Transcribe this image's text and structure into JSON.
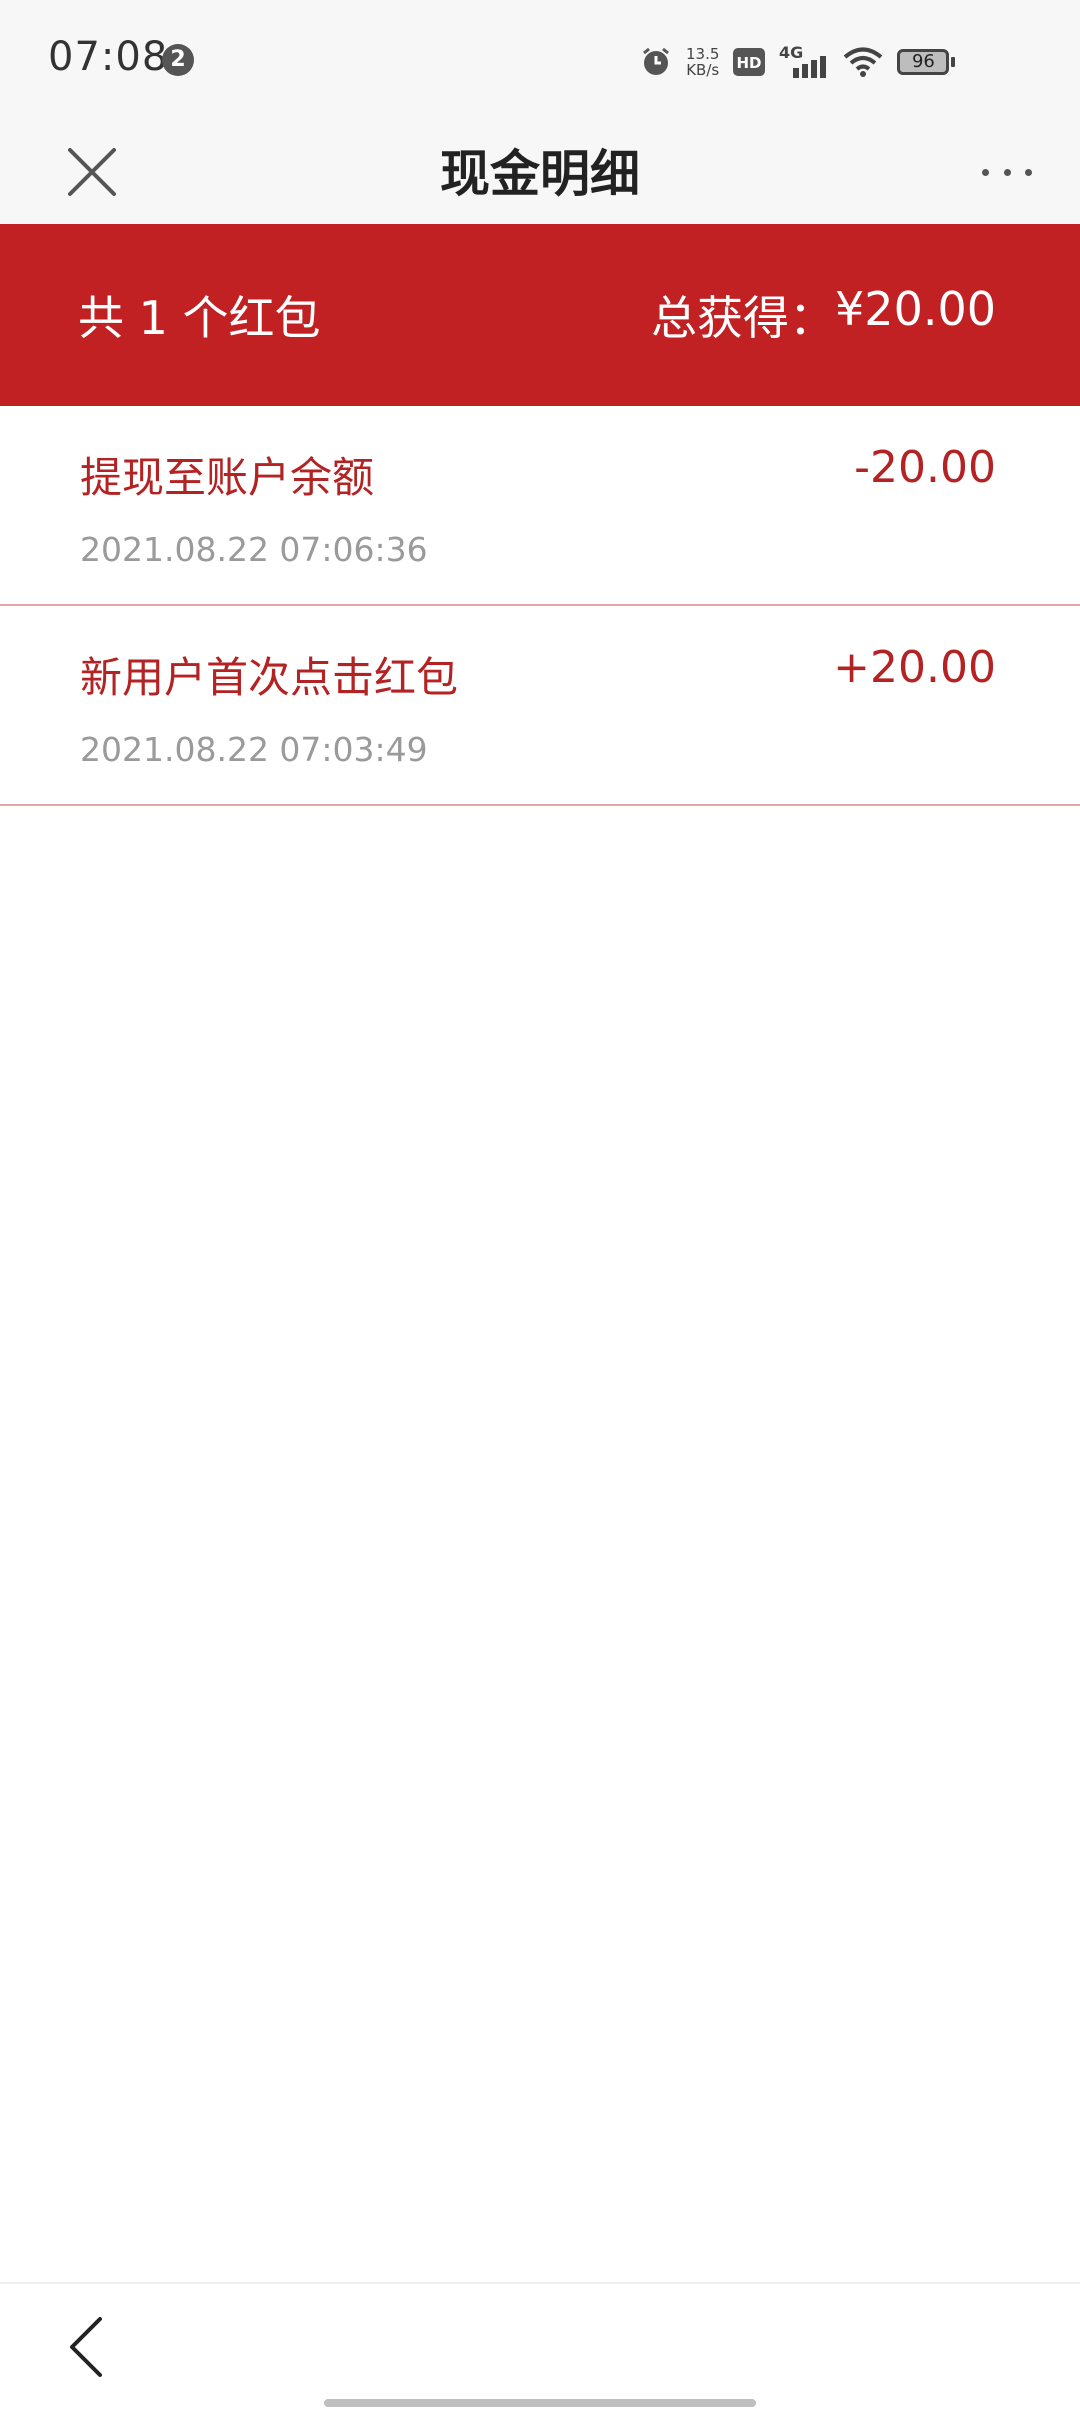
{
  "status_bar": {
    "time": "07:08",
    "notification_count": "2",
    "net_speed_value": "13.5",
    "net_speed_unit": "KB/s",
    "hd_label": "HD",
    "network_label": "4G",
    "battery_level": "96"
  },
  "header": {
    "title": "现金明细"
  },
  "summary": {
    "count_text": "共 1 个红包",
    "total_label": "总获得：",
    "total_value": "¥20.00"
  },
  "records": [
    {
      "title": "提现至账户余额",
      "time": "2021.08.22 07:06:36",
      "amount": "-20.00"
    },
    {
      "title": "新用户首次点击红包",
      "time": "2021.08.22 07:03:49",
      "amount": "+20.00"
    }
  ],
  "colors": {
    "accent_red": "#c12123",
    "amount_red": "#b42323",
    "divider": "#e3a6a6"
  }
}
